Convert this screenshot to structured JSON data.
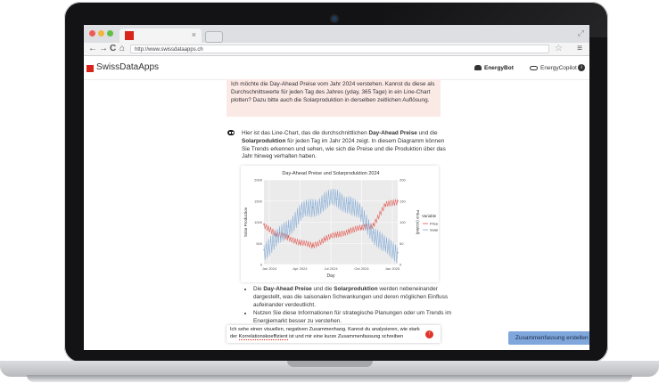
{
  "browser": {
    "url": "http://www.swissdataapps.ch",
    "tab_close": "×",
    "resize_icon": "⤢",
    "nav_back": "←",
    "nav_forward": "→",
    "nav_reload": "C",
    "nav_home": "⌂",
    "star": "☆",
    "menu": "≡"
  },
  "app": {
    "brand": "SwissDataApps",
    "brand_color": "#d9241b",
    "nav": {
      "energybot": "EnergyBot",
      "energycopilot": "EnergyCopilot",
      "info": "i"
    }
  },
  "chat": {
    "user_message": "Ich möchte die Day-Ahead Preise vom Jahr 2024 verstehen. Kannst du diese als Durchschnittswerte für jeden Tag des Jahres (yday, 365 Tage) in ein Line-Chart plotten? Dazu bitte auch die Solarproduktion in derselben zeitlichen Auflösung.",
    "bot_intro": {
      "t1": "Hier ist das Line-Chart, das die durchschnittlichen ",
      "b1": "Day-Ahead Preise",
      "t2": " und die ",
      "b2": "Solarproduktion",
      "t3": " für jeden Tag im Jahr 2024 zeigt. In diesem Diagramm können Sie Trends erkennen und sehen, wie sich die Preise und die Produktion über das Jahr hinweg verhalten haben."
    },
    "bullets": [
      {
        "t1": "Die ",
        "b1": "Day-Ahead Preise",
        "t2": " und die ",
        "b2": "Solarproduktion",
        "t3": " werden nebeneinander dargestellt, was die saisonalen Schwankungen und deren möglichen Einfluss aufeinander verdeutlicht."
      },
      {
        "t1": "Nutzen Sie diese Informationen für strategische Planungen oder um Trends im Energiemarkt besser zu verstehen."
      }
    ],
    "input": {
      "t1": "Ich sehe einen visuellen, negativen Zusammenhang. Kannst du analysieren, wie stark der ",
      "u1": "Korrelationskoeffizient",
      "t2": " ist und mir eine kurze Zusammenfassung schreiben"
    },
    "send_icon": "↑",
    "summary_button": "Zusammenfassung erstellen"
  },
  "chart_data": {
    "type": "line",
    "title": "Day-Ahead Preise und Solarproduktion 2024",
    "xlabel": "Day",
    "ylabel_left": "Solar Production",
    "ylabel_right": "Price (scaled)",
    "x_ticks": [
      "Jan 2024",
      "Apr 2024",
      "Jul 2024",
      "Oct 2024",
      "Jan 2025"
    ],
    "y_left_ticks": [
      0,
      500,
      1000,
      1500,
      2000
    ],
    "y_right_ticks": [
      0,
      50,
      100,
      150,
      200
    ],
    "ylim_left": [
      0,
      2000
    ],
    "ylim_right": [
      0,
      200
    ],
    "legend_title": "Variable",
    "legend_position": "right",
    "grid": true,
    "series": [
      {
        "name": "Price",
        "color": "#e2544c",
        "axis": "right",
        "months": [
          "Jan",
          "Feb",
          "Mar",
          "Apr",
          "May",
          "Jun",
          "Jul",
          "Aug",
          "Sep",
          "Oct",
          "Nov",
          "Dec"
        ],
        "values": [
          95,
          70,
          65,
          50,
          45,
          60,
          70,
          80,
          85,
          95,
          140,
          150
        ]
      },
      {
        "name": "Solar",
        "color": "#7fa9d6",
        "axis": "left",
        "months": [
          "Jan",
          "Feb",
          "Mar",
          "Apr",
          "May",
          "Jun",
          "Jul",
          "Aug",
          "Sep",
          "Oct",
          "Nov",
          "Dec"
        ],
        "values": [
          350,
          550,
          900,
          1200,
          1350,
          1500,
          1550,
          1450,
          1150,
          750,
          400,
          280
        ]
      }
    ]
  }
}
